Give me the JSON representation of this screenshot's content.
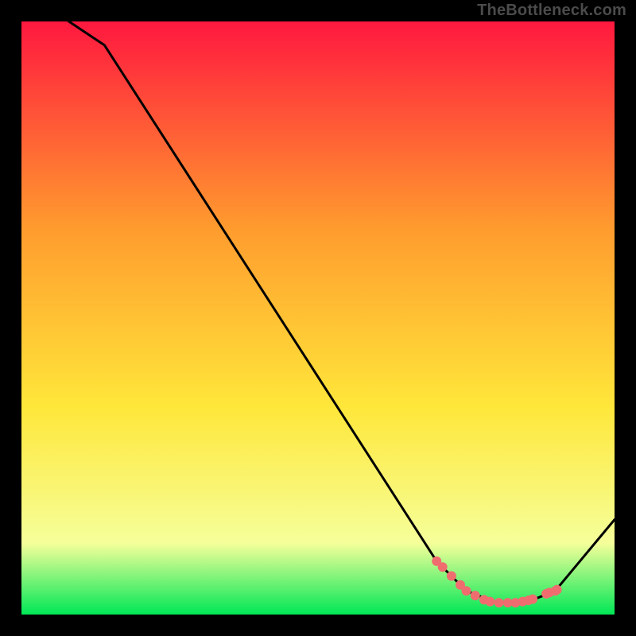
{
  "watermark": "TheBottleneck.com",
  "colors": {
    "page_bg": "#000000",
    "gradient_top": "#ff183f",
    "gradient_mid_top": "#ff9c2e",
    "gradient_mid_bot": "#ffe73a",
    "gradient_pale": "#f5ff9a",
    "gradient_bottom": "#00e756",
    "curve": "#000000",
    "marker": "#ef6d6f"
  },
  "chart_data": {
    "type": "line",
    "title": "",
    "xlabel": "",
    "ylabel": "",
    "xlim": [
      0,
      100
    ],
    "ylim": [
      0,
      100
    ],
    "curve": {
      "x": [
        0,
        3,
        8,
        14,
        70,
        75,
        80,
        85,
        90,
        100
      ],
      "y": [
        110,
        104,
        100,
        96,
        9,
        4,
        2,
        2,
        4,
        16
      ]
    },
    "markers": {
      "x": [
        70,
        71,
        72.5,
        74,
        75,
        76.5,
        78,
        79,
        80.5,
        82,
        83.3,
        84.5,
        85.5,
        86.2,
        88.5,
        89,
        90,
        90.3
      ],
      "y": [
        9,
        8,
        6.5,
        5,
        4,
        3.2,
        2.5,
        2.2,
        2,
        2,
        2,
        2.2,
        2.4,
        2.6,
        3.5,
        3.7,
        4,
        4.2
      ]
    }
  }
}
